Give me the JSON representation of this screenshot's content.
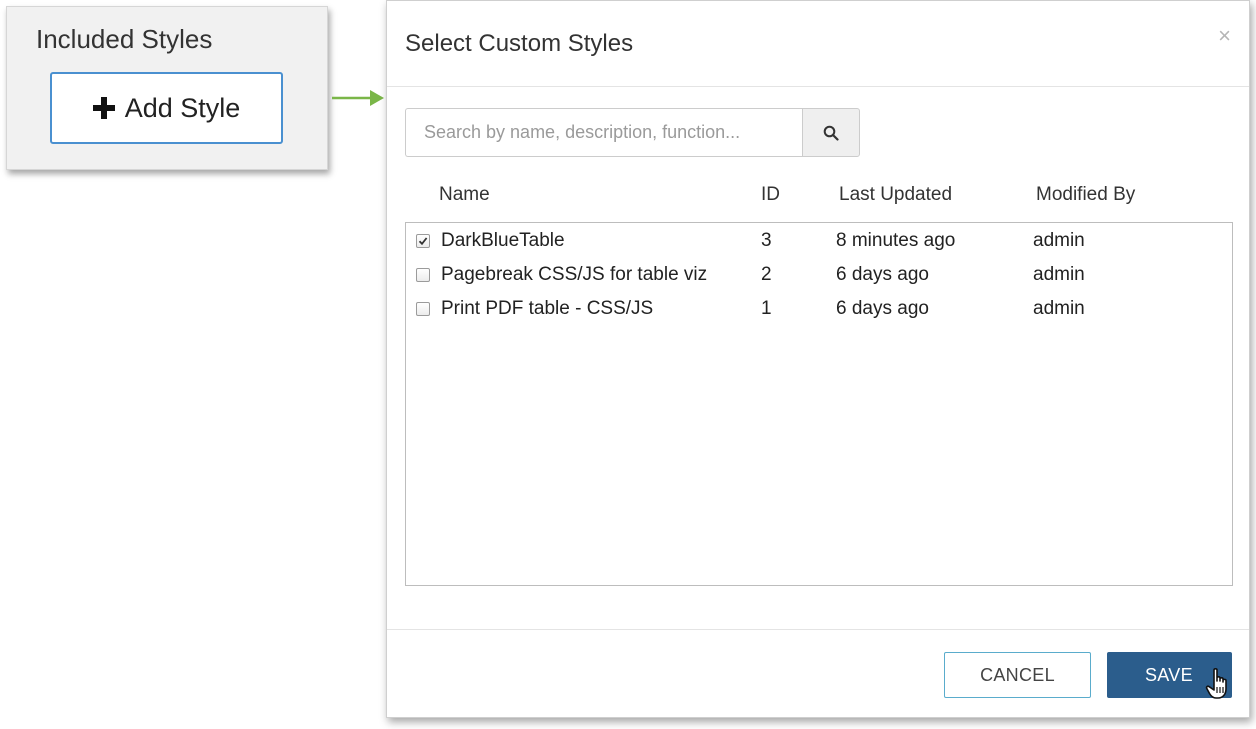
{
  "included_styles": {
    "title": "Included Styles",
    "add_button_label": "Add Style",
    "add_icon": "plus-icon"
  },
  "arrow_color": "#7ab648",
  "modal": {
    "title": "Select Custom Styles",
    "close_icon": "close-icon",
    "close_glyph": "×",
    "search": {
      "placeholder": "Search by name, description, function...",
      "value": "",
      "icon": "search-icon"
    },
    "columns": [
      "Name",
      "ID",
      "Last Updated",
      "Modified By"
    ],
    "rows": [
      {
        "checked": true,
        "name": "DarkBlueTable",
        "id": "3",
        "last_updated": "8 minutes ago",
        "modified_by": "admin"
      },
      {
        "checked": false,
        "name": "Pagebreak CSS/JS for table viz",
        "id": "2",
        "last_updated": "6 days ago",
        "modified_by": "admin"
      },
      {
        "checked": false,
        "name": "Print PDF table - CSS/JS",
        "id": "1",
        "last_updated": "6 days ago",
        "modified_by": "admin"
      }
    ],
    "footer": {
      "cancel_label": "CANCEL",
      "save_label": "SAVE"
    }
  },
  "colors": {
    "save_bg": "#2b5d8c",
    "add_button_border": "#4a90d0",
    "cancel_border": "#5aaccc"
  }
}
